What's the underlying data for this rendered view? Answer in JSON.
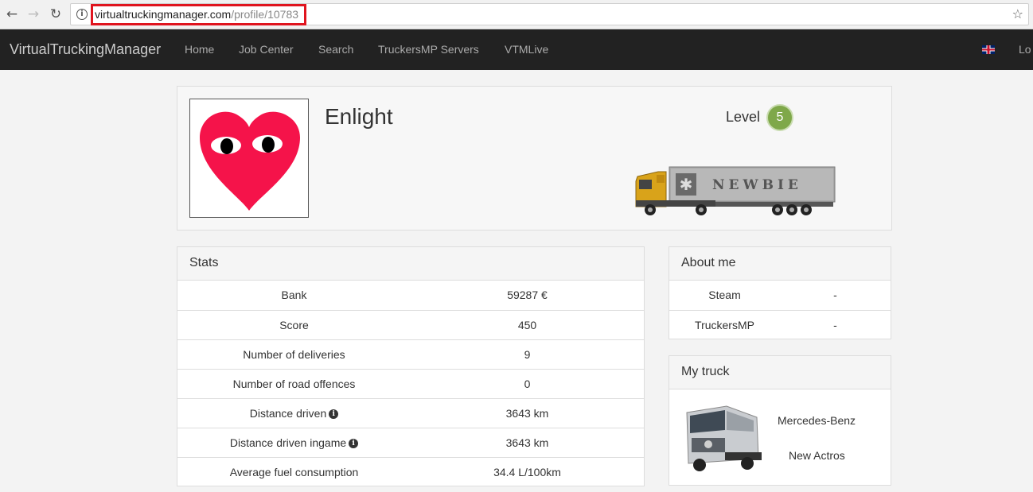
{
  "browser": {
    "url_domain": "virtualtruckingmanager.com",
    "url_path": "/profile/10783",
    "back_icon": "arrow-left-icon",
    "forward_icon": "arrow-right-icon",
    "reload_icon": "reload-icon",
    "star_icon": "star-icon"
  },
  "navbar": {
    "brand": "VirtualTruckingManager",
    "items": [
      "Home",
      "Job Center",
      "Search",
      "TruckersMP Servers",
      "VTMLive"
    ],
    "login_partial": "Lo"
  },
  "profile": {
    "username": "Enlight",
    "level_label": "Level",
    "level": "5",
    "trailer_text": "NEWBIE"
  },
  "stats": {
    "title": "Stats",
    "rows": [
      {
        "label": "Bank",
        "value": "59287 €",
        "info": false
      },
      {
        "label": "Score",
        "value": "450",
        "info": false
      },
      {
        "label": "Number of deliveries",
        "value": "9",
        "info": false
      },
      {
        "label": "Number of road offences",
        "value": "0",
        "info": false
      },
      {
        "label": "Distance driven",
        "value": "3643 km",
        "info": true
      },
      {
        "label": "Distance driven ingame",
        "value": "3643 km",
        "info": true
      },
      {
        "label": "Average fuel consumption",
        "value": "34.4 L/100km",
        "info": false
      }
    ]
  },
  "about": {
    "title": "About me",
    "rows": [
      {
        "label": "Steam",
        "value": "-"
      },
      {
        "label": "TruckersMP",
        "value": "-"
      }
    ]
  },
  "truck": {
    "title": "My truck",
    "make": "Mercedes-Benz",
    "model": "New Actros"
  },
  "colors": {
    "navbar_bg": "#222222",
    "level_badge": "#7fa84a",
    "url_highlight": "#e0141e"
  }
}
